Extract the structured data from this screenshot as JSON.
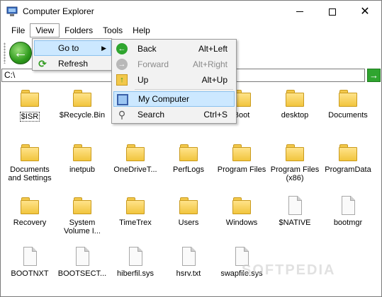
{
  "window": {
    "title": "Computer Explorer"
  },
  "menubar": [
    "File",
    "View",
    "Folders",
    "Tools",
    "Help"
  ],
  "view_menu": {
    "items": [
      {
        "label": "Go to",
        "has_submenu": true
      },
      {
        "label": "Refresh"
      }
    ]
  },
  "goto_menu": {
    "items": [
      {
        "label": "Back",
        "shortcut": "Alt+Left",
        "icon": "back-arrow-icon"
      },
      {
        "label": "Forward",
        "shortcut": "Alt+Right",
        "icon": "forward-arrow-icon",
        "disabled": true
      },
      {
        "label": "Up",
        "shortcut": "Alt+Up",
        "icon": "up-folder-icon"
      },
      {
        "label": "My Computer",
        "shortcut": "",
        "icon": "computer-icon",
        "highlighted": true
      },
      {
        "label": "Search",
        "shortcut": "Ctrl+S",
        "icon": "search-icon"
      }
    ]
  },
  "address": {
    "value": "C:\\"
  },
  "files": [
    {
      "label": "$ISR",
      "type": "folder"
    },
    {
      "label": "$Recycle.Bin",
      "type": "folder"
    },
    {
      "label": "",
      "type": "folder"
    },
    {
      "label": "",
      "type": "folder"
    },
    {
      "label": "Boot",
      "type": "folder"
    },
    {
      "label": "desktop",
      "type": "folder"
    },
    {
      "label": "Documents",
      "type": "folder"
    },
    {
      "label": "Documents and Settings",
      "type": "folder"
    },
    {
      "label": "inetpub",
      "type": "folder"
    },
    {
      "label": "OneDriveT...",
      "type": "folder"
    },
    {
      "label": "PerfLogs",
      "type": "folder"
    },
    {
      "label": "Program Files",
      "type": "folder"
    },
    {
      "label": "Program Files (x86)",
      "type": "folder"
    },
    {
      "label": "ProgramData",
      "type": "folder"
    },
    {
      "label": "Recovery",
      "type": "folder"
    },
    {
      "label": "System Volume I...",
      "type": "folder"
    },
    {
      "label": "TimeTrex",
      "type": "folder"
    },
    {
      "label": "Users",
      "type": "folder"
    },
    {
      "label": "Windows",
      "type": "folder"
    },
    {
      "label": "$NATIVE",
      "type": "file"
    },
    {
      "label": "bootmgr",
      "type": "file"
    },
    {
      "label": "BOOTNXT",
      "type": "file"
    },
    {
      "label": "BOOTSECT...",
      "type": "file"
    },
    {
      "label": "hiberfil.sys",
      "type": "file"
    },
    {
      "label": "hsrv.txt",
      "type": "file"
    },
    {
      "label": "swapfile.sys",
      "type": "file"
    }
  ],
  "watermark": "SOFTPEDIA"
}
